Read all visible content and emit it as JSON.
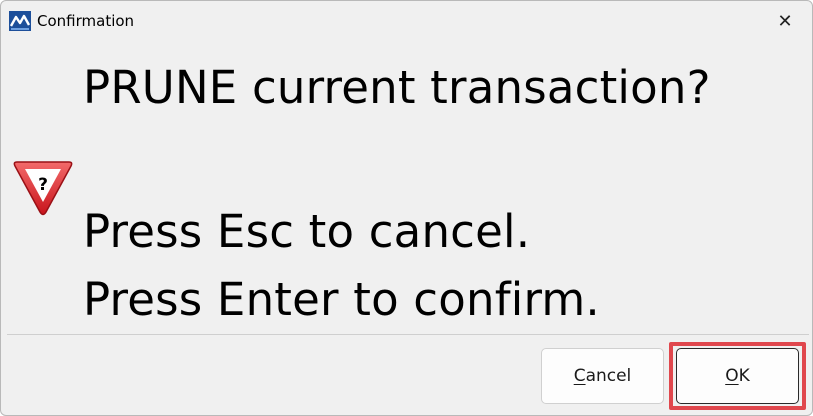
{
  "window": {
    "title": "Confirmation",
    "app_icon": "app-logo-icon",
    "close_icon": "close-icon",
    "close_glyph": "✕"
  },
  "message": {
    "icon": "warning-question-icon",
    "icon_glyph": "?",
    "lines": [
      "PRUNE current transaction?",
      "Press Esc to cancel.",
      "Press Enter to confirm."
    ]
  },
  "buttons": {
    "cancel": {
      "first": "C",
      "rest": "ancel"
    },
    "ok": {
      "first": "O",
      "rest": "K"
    }
  },
  "colors": {
    "dialog_bg": "#f0f0f0",
    "warning_red": "#e0303a",
    "highlight": "#e0474d"
  }
}
